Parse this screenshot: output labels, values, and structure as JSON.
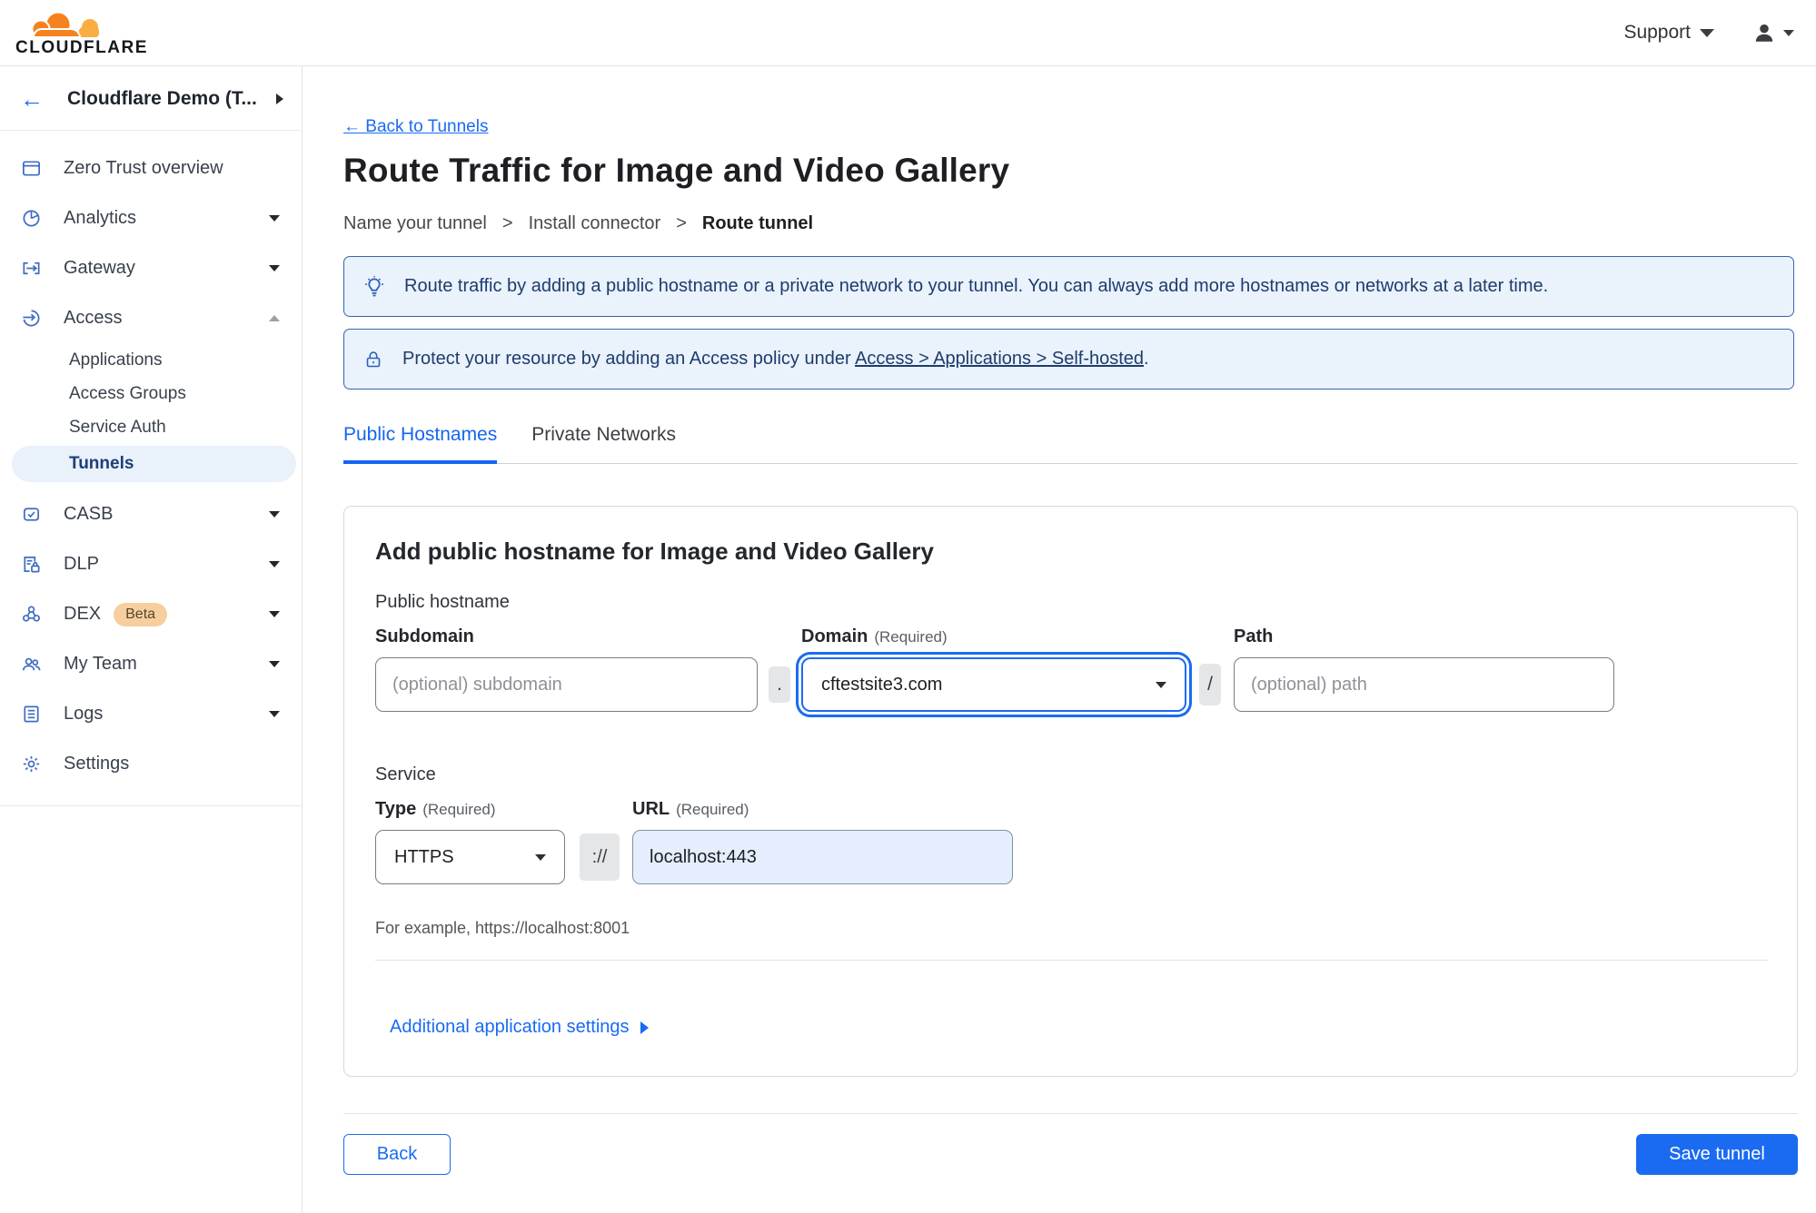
{
  "topbar": {
    "logo_text": "CLOUDFLARE",
    "support_label": "Support"
  },
  "sidebar": {
    "back_arrow": "←",
    "account_name": "Cloudflare Demo (T...",
    "items": {
      "overview": "Zero Trust overview",
      "analytics": "Analytics",
      "gateway": "Gateway",
      "access": "Access",
      "applications": "Applications",
      "access_groups": "Access Groups",
      "service_auth": "Service Auth",
      "tunnels": "Tunnels",
      "casb": "CASB",
      "dlp": "DLP",
      "dex": "DEX",
      "dex_badge": "Beta",
      "my_team": "My Team",
      "logs": "Logs",
      "settings": "Settings"
    }
  },
  "header": {
    "back_link": "← Back to Tunnels",
    "title": "Route Traffic for Image and Video Gallery",
    "breadcrumb": {
      "step1": "Name your tunnel",
      "separator": ">",
      "step2": "Install connector",
      "step3": "Route tunnel"
    }
  },
  "banners": {
    "route_info": "Route traffic by adding a public hostname or a private network to your tunnel. You can always add more hostnames or networks at a later time.",
    "protect_prefix": "Protect your resource by adding an Access policy under",
    "protect_link": "Access > Applications > Self-hosted",
    "protect_suffix": "."
  },
  "tabs": {
    "public_hostnames": "Public Hostnames",
    "private_networks": "Private Networks"
  },
  "form": {
    "heading": "Add public hostname for Image and Video Gallery",
    "public_hostname_label": "Public hostname",
    "subdomain_label": "Subdomain",
    "domain_label": "Domain",
    "path_label": "Path",
    "required_label": "(Required)",
    "subdomain_placeholder": "(optional) subdomain",
    "domain_value": "cftestsite3.com",
    "path_placeholder": "(optional) path",
    "dot_separator": ".",
    "slash_separator": "/",
    "service_label": "Service",
    "type_label": "Type",
    "url_label": "URL",
    "type_value": "HTTPS",
    "scheme_separator": "://",
    "url_value": "localhost:443",
    "example_text": "For example, https://localhost:8001",
    "additional_settings_label": "Additional application settings"
  },
  "footer": {
    "back_button": "Back",
    "save_button": "Save tunnel"
  },
  "colors": {
    "accent_blue": "#1a6bf2",
    "banner_bg": "#eaf2fb",
    "banner_border": "#3a64ad",
    "banner_text": "#1e3c6d",
    "selected_item_bg": "#e9f1fb",
    "beta_badge_bg": "#f7cf9e",
    "logo_orange_dark": "#f6821f",
    "logo_orange_light": "#fbad41"
  }
}
